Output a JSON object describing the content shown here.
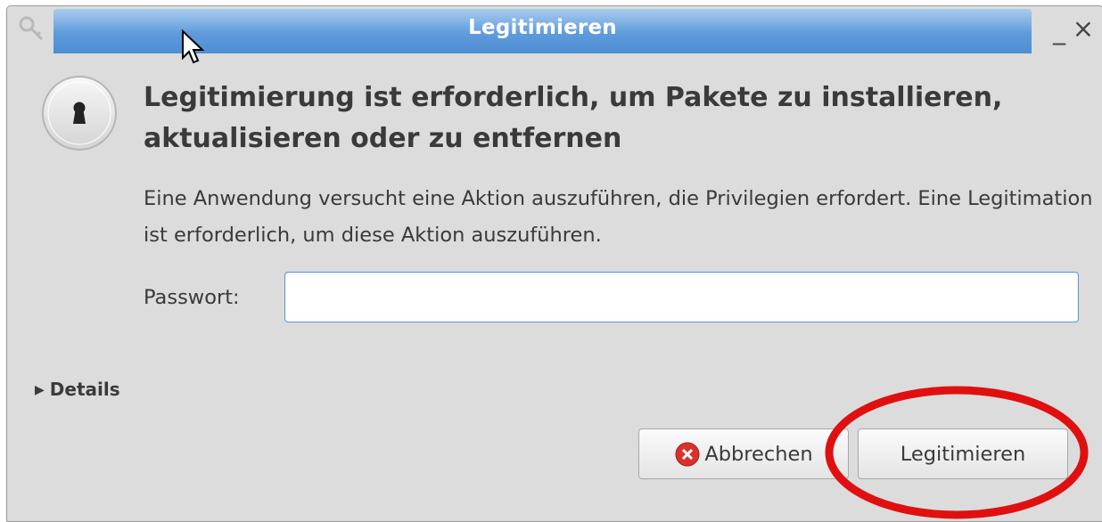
{
  "window": {
    "title": "Legitimieren",
    "minimize_glyph": "_",
    "close_glyph": "×"
  },
  "dialog": {
    "heading": "Legitimierung ist erforderlich, um Pakete zu installieren, aktualisieren oder zu entfernen",
    "description": "Eine Anwendung versucht eine Aktion auszuführen, die Privilegien erfordert. Eine Legitimation ist erforderlich, um diese Aktion auszuführen.",
    "password_label": "Passwort:",
    "password_value": "",
    "details_label": "Details",
    "cancel_label": "Abbrechen",
    "authenticate_label": "Legitimieren"
  },
  "icons": {
    "app": "key-icon",
    "lock": "lock-icon",
    "cancel": "cancel-icon",
    "details_expander": "triangle-right-icon"
  },
  "colors": {
    "titlebar_accent": "#4f8ed5",
    "annotation_circle": "#e01010",
    "cancel_icon": "#d9322b"
  }
}
